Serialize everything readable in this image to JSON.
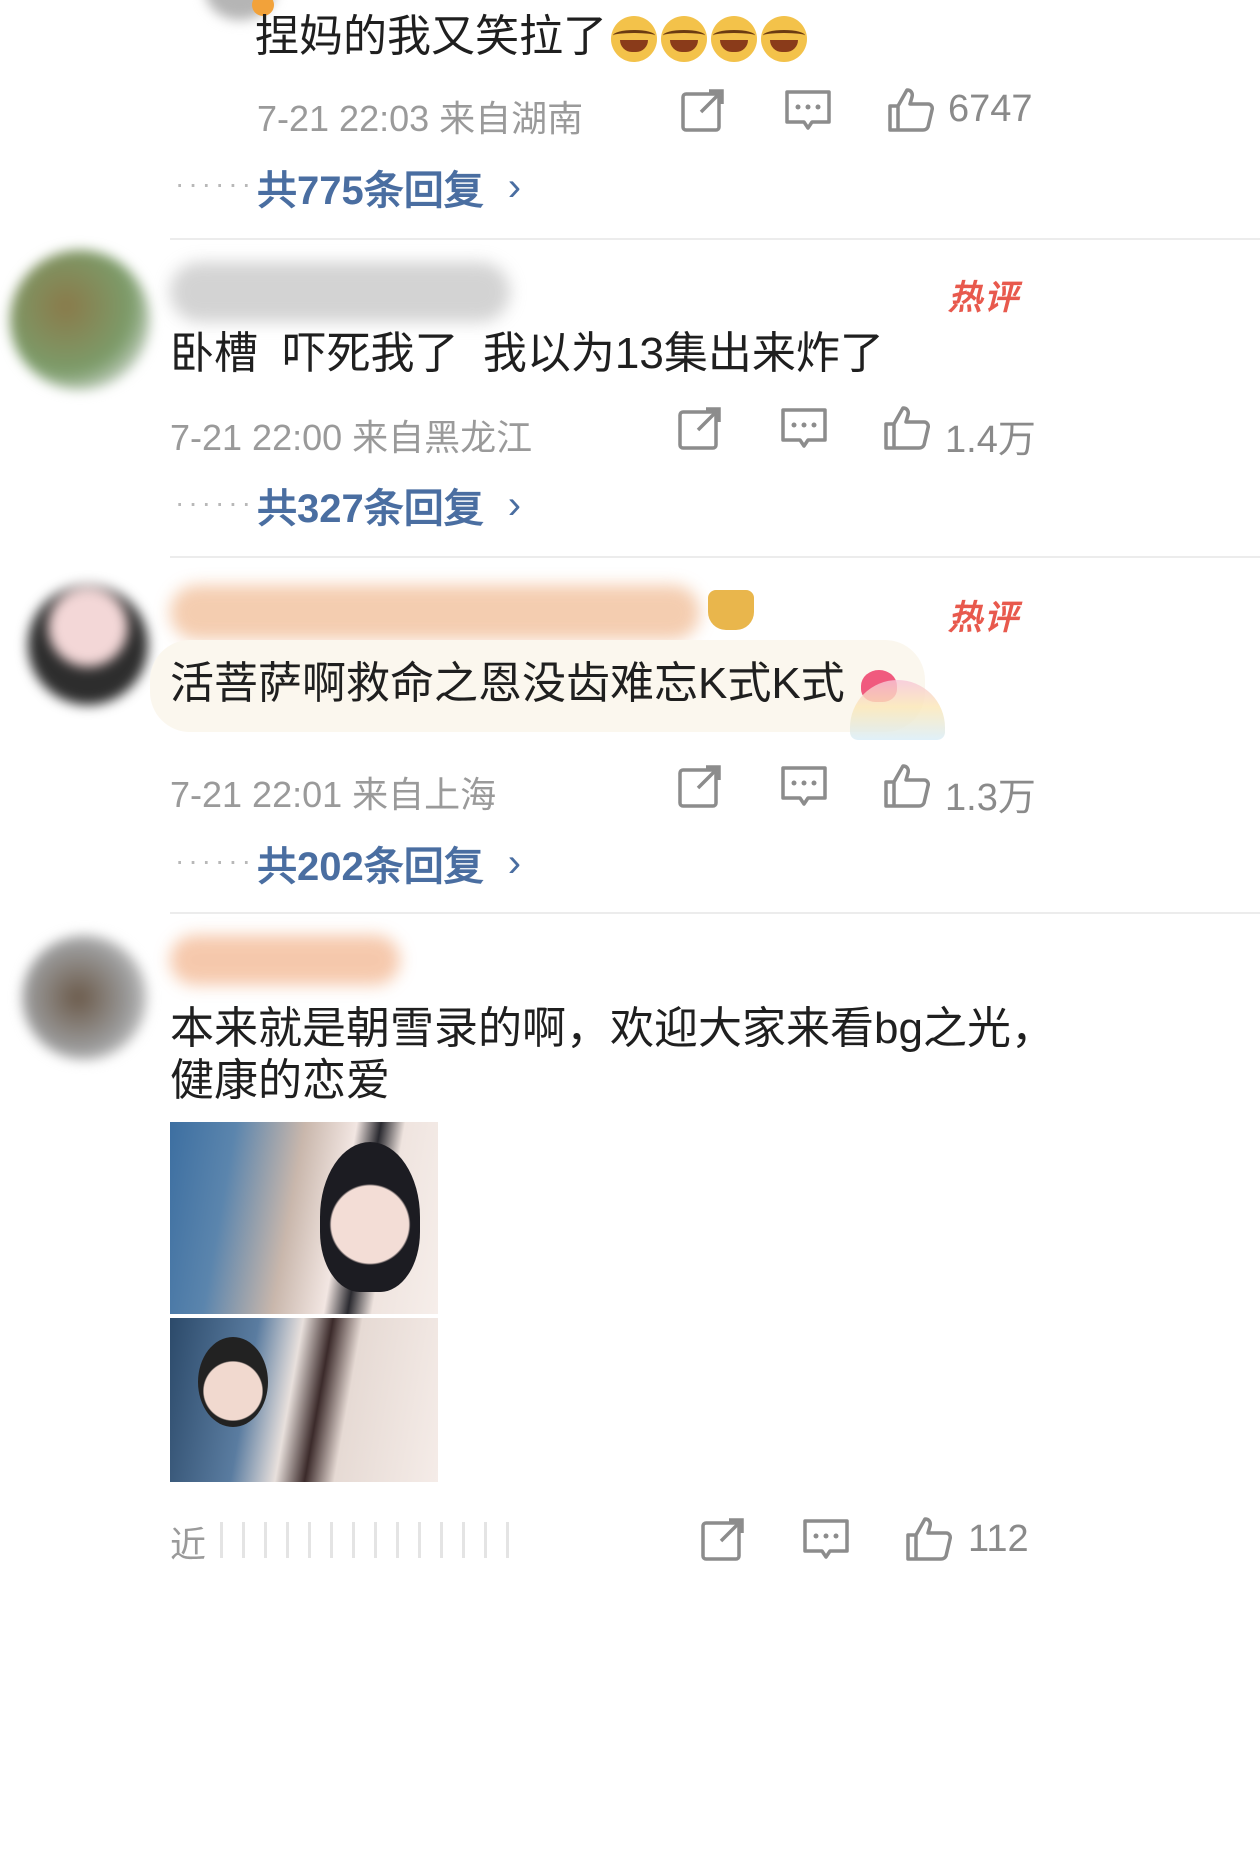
{
  "comments": [
    {
      "text": "捏妈的我又笑拉了",
      "meta": "7-21 22:03 来自湖南",
      "likes": "6747",
      "replies": "共775条回复"
    },
    {
      "text": "卧槽  吓死我了  我以为13集出来炸了",
      "meta": "7-21 22:00 来自黑龙江",
      "likes": "1.4万",
      "replies": "共327条回复",
      "badge": "热评"
    },
    {
      "text": "活菩萨啊救命之恩没齿难忘K式K式",
      "meta": "7-21 22:01 来自上海",
      "likes": "1.3万",
      "replies": "共202条回复",
      "badge": "热评"
    },
    {
      "text_line1": "本来就是朝雪录的啊，欢迎大家来看bg之光，",
      "text_line2": "健康的恋爱",
      "meta": "近",
      "likes": "112"
    }
  ],
  "colors": {
    "link_blue": "#4a6ea1",
    "hot_red": "#e8594d",
    "meta_gray": "#9a9a9a"
  },
  "icons": [
    "share-icon",
    "comment-icon",
    "like-icon",
    "chevron-right-icon",
    "verified-badge-icon",
    "crown-badge-icon",
    "heart-sticker-icon"
  ]
}
